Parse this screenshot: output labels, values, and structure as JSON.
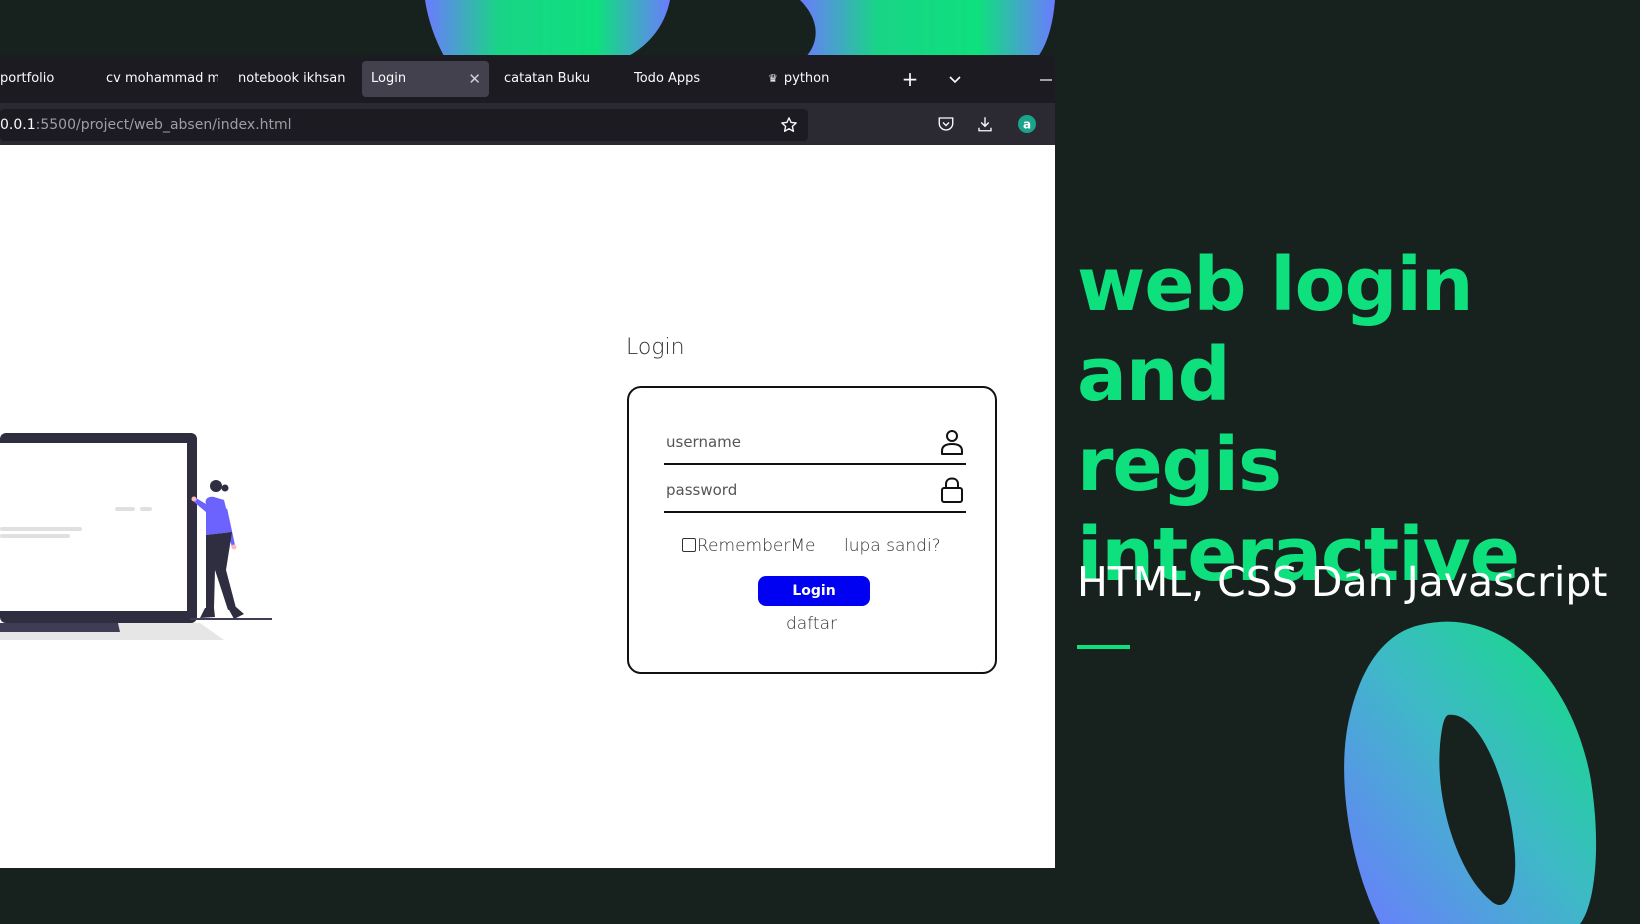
{
  "browser": {
    "tabs": [
      {
        "label": "portfolio",
        "active": false
      },
      {
        "label": "cv mohammad m",
        "active": false
      },
      {
        "label": "notebook ikhsan",
        "active": false
      },
      {
        "label": "Login",
        "active": true
      },
      {
        "label": "catatan Buku",
        "active": false
      },
      {
        "label": "Todo Apps",
        "active": false
      },
      {
        "label": "python",
        "active": false
      }
    ],
    "url_host": "0.0.1",
    "url_rest": ":5500/project/web_absen/index.html"
  },
  "page": {
    "login_title": "Login",
    "username_placeholder": "username",
    "password_placeholder": "password",
    "remember_label": "RememberMe",
    "forgot_label": "lupa sandi?",
    "login_button": "Login",
    "signup_link": "daftar"
  },
  "banner": {
    "headline_line1": "web login and",
    "headline_line2": "regis",
    "headline_line3": "interactive",
    "subheadline": "HTML, CSS Dan Javascript"
  },
  "colors": {
    "background": "#17221e",
    "accent_green": "#0ee07d",
    "blob_blue": "#6b7bff",
    "login_button": "#0000f2",
    "browser_chrome": "#1c1b22",
    "illustration_figure": "#6c63ff"
  },
  "icons": [
    "user-icon",
    "lock-icon",
    "close-icon",
    "plus-icon",
    "chevron-down-icon",
    "star-icon",
    "pocket-icon",
    "download-icon",
    "account-icon",
    "minimize-icon"
  ]
}
